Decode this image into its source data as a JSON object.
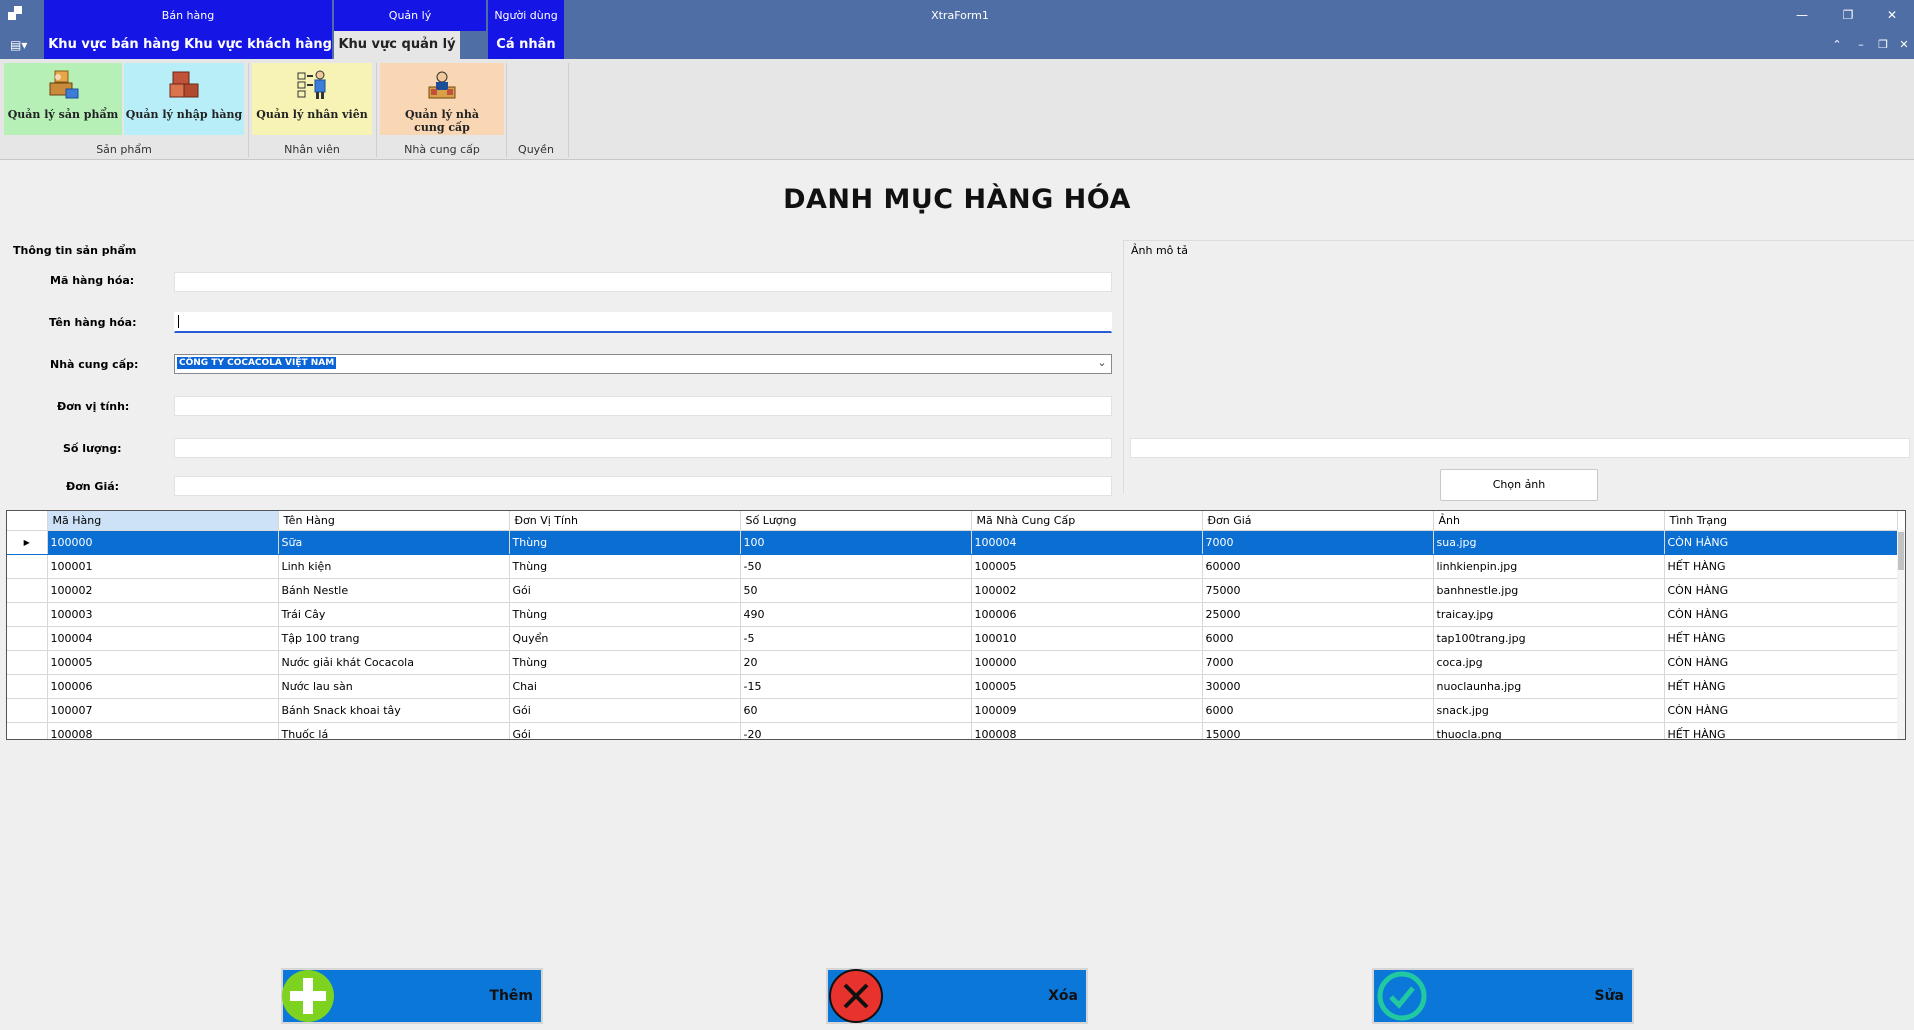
{
  "window": {
    "title": "XtraForm1",
    "context_groups": [
      "Bán hàng",
      "Quản lý",
      "Người dùng"
    ],
    "controls": {
      "minimize": "—",
      "restore": "❐",
      "close": "✕",
      "mdi_up": "⌃",
      "mdi_min": "–",
      "mdi_restore": "❐",
      "mdi_close": "✕"
    }
  },
  "tabs": [
    "Khu vực bán hàng",
    "Khu vực khách hàng",
    "Khu vực quản lý",
    "Cá nhân"
  ],
  "ribbon": {
    "buttons": [
      {
        "label": "Quản lý sản phẩm",
        "icon": "product-box-icon"
      },
      {
        "label": "Quản lý nhập hàng",
        "icon": "boxes-icon"
      },
      {
        "label": "Quản lý nhân viên",
        "icon": "staff-icon"
      },
      {
        "label": "Quản lý nhà cung cấp",
        "icon": "supplier-icon"
      }
    ],
    "groups": [
      "Sản phẩm",
      "Nhân viên",
      "Nhà cung cấp",
      "Quyền"
    ]
  },
  "page": {
    "title": "DANH MỤC HÀNG HÓA"
  },
  "form": {
    "group_title": "Thông tin sản phẩm",
    "labels": {
      "ma_hang": "Mã hàng hóa:",
      "ten_hang": "Tên hàng hóa:",
      "nha_cung_cap": "Nhà cung cấp:",
      "don_vi_tinh": "Đơn vị tính:",
      "so_luong": "Số lượng:",
      "don_gia": "Đơn Giá:"
    },
    "values": {
      "ma_hang": "",
      "ten_hang": "",
      "nha_cung_cap": "CÔNG TY COCACOLA VIỆT NAM",
      "don_vi_tinh": "",
      "so_luong": "",
      "don_gia": ""
    }
  },
  "image_panel": {
    "title": "Ảnh mô tả",
    "choose_button": "Chọn ảnh"
  },
  "grid": {
    "columns": [
      "Mã Hàng",
      "Tên Hàng",
      "Đơn Vị Tính",
      "Số Lượng",
      "Mã Nhà Cung Cấp",
      "Đơn Giá",
      "Ảnh",
      "Tình Trạng"
    ],
    "rows": [
      [
        "100000",
        "Sữa",
        "Thùng",
        "100",
        "100004",
        "7000",
        "sua.jpg",
        "CÒN HÀNG"
      ],
      [
        "100001",
        "Linh kiện",
        "Thùng",
        "-50",
        "100005",
        "60000",
        "linhkienpin.jpg",
        "HẾT HÀNG"
      ],
      [
        "100002",
        "Bánh Nestle",
        "Gói",
        "50",
        "100002",
        "75000",
        "banhnestle.jpg",
        "CÒN HÀNG"
      ],
      [
        "100003",
        "Trái Cây",
        "Thùng",
        "490",
        "100006",
        "25000",
        "traicay.jpg",
        "CÒN HÀNG"
      ],
      [
        "100004",
        "Tập 100 trang",
        "Quyển",
        "-5",
        "100010",
        "6000",
        "tap100trang.jpg",
        "HẾT HÀNG"
      ],
      [
        "100005",
        "Nước giải khát Cocacola",
        "Thùng",
        "20",
        "100000",
        "7000",
        "coca.jpg",
        "CÒN HÀNG"
      ],
      [
        "100006",
        "Nước lau sàn",
        "Chai",
        "-15",
        "100005",
        "30000",
        "nuoclaunha.jpg",
        "HẾT HÀNG"
      ],
      [
        "100007",
        "Bánh Snack khoai tây",
        "Gói",
        "60",
        "100009",
        "6000",
        "snack.jpg",
        "CÒN HÀNG"
      ],
      [
        "100008",
        "Thuốc lá",
        "Gói",
        "-20",
        "100008",
        "15000",
        "thuocla.png",
        "HẾT HÀNG"
      ]
    ],
    "selected_row": 0
  },
  "actions": [
    {
      "label": "Thêm",
      "icon": "plus-icon",
      "color": "#7ed321"
    },
    {
      "label": "Xóa",
      "icon": "x-icon",
      "color": "#e8322e"
    },
    {
      "label": "Sửa",
      "icon": "check-icon",
      "color": "#22c9a0"
    }
  ],
  "colors": {
    "accent": "#1515e6",
    "titlebar": "#4f6ea5",
    "selection": "#0a6ed2",
    "button": "#0a77d9"
  }
}
